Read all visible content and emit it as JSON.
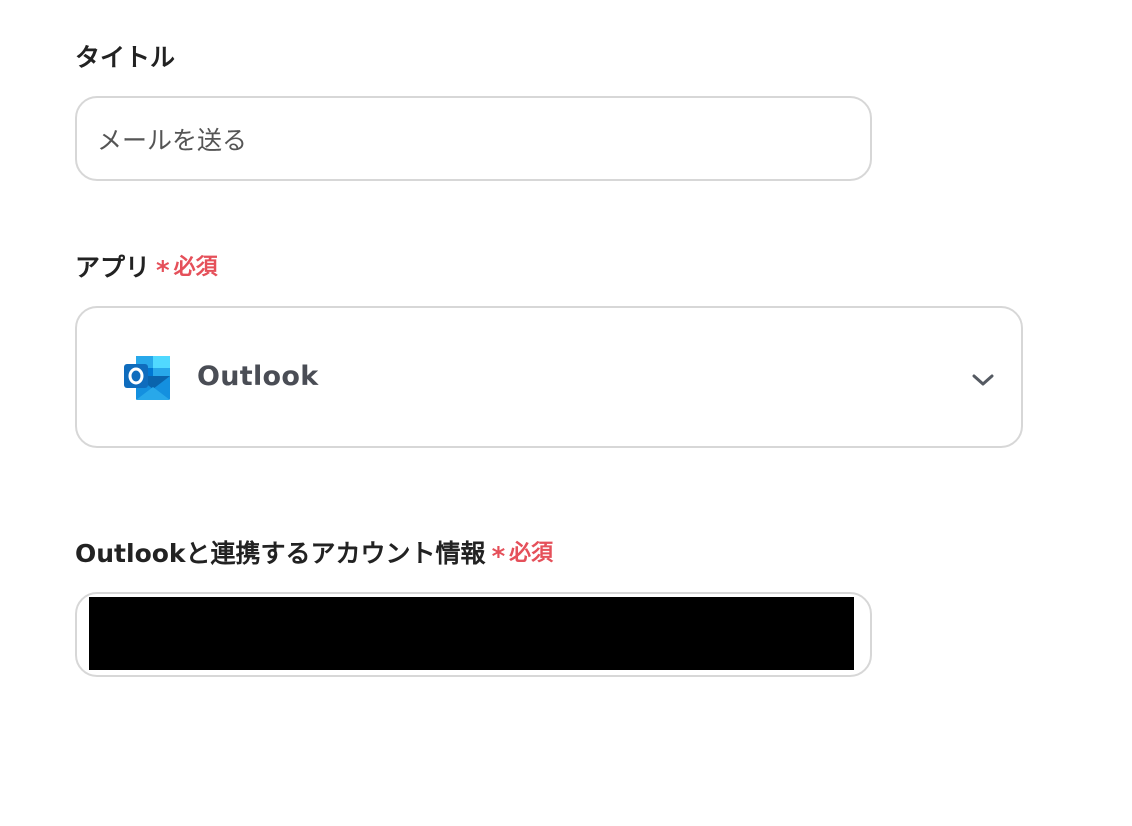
{
  "title_field": {
    "label": "タイトル",
    "value": "メールを送る"
  },
  "app_field": {
    "label": "アプリ",
    "required_mark": "*",
    "required_text": "必須",
    "selected_app": "Outlook",
    "icon": "outlook-icon"
  },
  "account_field": {
    "label": "Outlookと連携するアカウント情報",
    "required_mark": "*",
    "required_text": "必須",
    "value": ""
  },
  "colors": {
    "required": "#e5505a",
    "border": "#d7d7d7",
    "label": "#222222",
    "outlook_blue": "#0f6cbd"
  }
}
